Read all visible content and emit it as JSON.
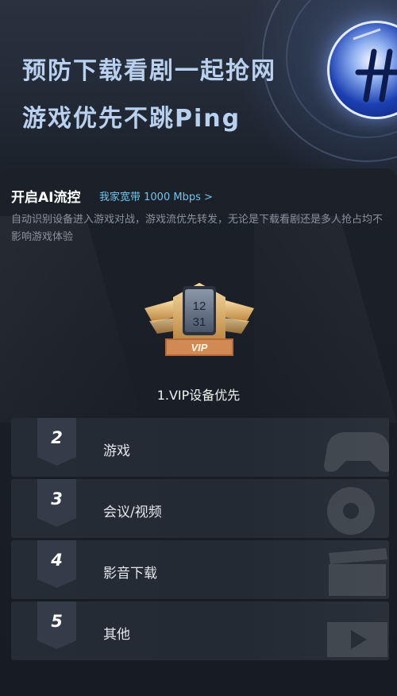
{
  "hero": {
    "line1": "预防下载看剧一起抢网",
    "line2": "游戏优先不跳Ping"
  },
  "ai_control": {
    "title": "开启AI流控",
    "bandwidth_link": "我家宽带 1000 Mbps >",
    "description": "自动识别设备进入游戏对战，游戏流优先转发，无论是下载看剧还是多人抢占均不影响游戏体验"
  },
  "vip_badge": {
    "date_line1": "12",
    "date_line2": "31",
    "tag": "VIP"
  },
  "vip_label": "1.VIP设备优先",
  "priorities": [
    {
      "rank": "2",
      "label": "游戏",
      "icon": "gamepad-icon"
    },
    {
      "rank": "3",
      "label": "会议/视频",
      "icon": "video-camera-icon"
    },
    {
      "rank": "4",
      "label": "影音下载",
      "icon": "clapperboard-icon"
    },
    {
      "rank": "5",
      "label": "其他",
      "icon": "film-icon"
    }
  ],
  "colors": {
    "background": "#141a22",
    "accent_link": "#6ec6ee",
    "hero_text": "#b9d1ee",
    "badge_gold": "#d9a95a"
  }
}
